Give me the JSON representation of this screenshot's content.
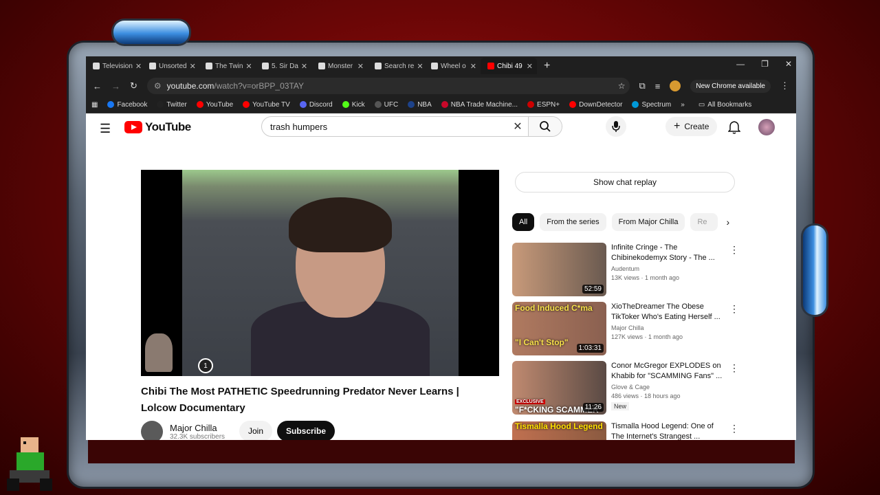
{
  "tabs": [
    {
      "label": "Television"
    },
    {
      "label": "Unsorted"
    },
    {
      "label": "The Twin"
    },
    {
      "label": "5. Sir Da"
    },
    {
      "label": "Monster"
    },
    {
      "label": "Search re"
    },
    {
      "label": "Wheel o"
    },
    {
      "label": "Chibi 49"
    }
  ],
  "address": {
    "url_host": "youtube.com",
    "url_path": "/watch?v=orBPP_03TAY",
    "new_chrome": "New Chrome available"
  },
  "bookmarks": [
    {
      "label": "Facebook",
      "color": "#1877f2"
    },
    {
      "label": "Twitter",
      "color": "#222222"
    },
    {
      "label": "YouTube",
      "color": "#ff0000"
    },
    {
      "label": "YouTube TV",
      "color": "#ff0000"
    },
    {
      "label": "Discord",
      "color": "#5865f2"
    },
    {
      "label": "Kick",
      "color": "#53fc18"
    },
    {
      "label": "UFC",
      "color": "#555555"
    },
    {
      "label": "NBA",
      "color": "#1d428a"
    },
    {
      "label": "NBA Trade Machine...",
      "color": "#c9082a"
    },
    {
      "label": "ESPN+",
      "color": "#cc0000"
    },
    {
      "label": "DownDetector",
      "color": "#ff0000"
    },
    {
      "label": "Spectrum",
      "color": "#0099d8"
    }
  ],
  "all_bookmarks": "All Bookmarks",
  "youtube": {
    "logo": "YouTube",
    "search_value": "trash humpers",
    "create": "Create"
  },
  "video": {
    "title": "Chibi The Most PATHETIC Speedrunning Predator Never Learns | Lolcow Documentary",
    "channel": "Major Chilla",
    "subscribers": "32.3K subscribers",
    "join": "Join",
    "subscribe": "Subscribe",
    "badge": "1"
  },
  "sidebar": {
    "chat_replay": "Show chat replay",
    "chips": [
      "All",
      "From the series",
      "From Major Chilla",
      "Re"
    ],
    "recommendations": [
      {
        "title": "Infinite Cringe - The Chibinekodemyx Story - The ...",
        "channel": "Audentum",
        "meta": "13K views · 1 month ago",
        "duration": "52:59",
        "caption": "",
        "thumb": "#b88a6a"
      },
      {
        "title": "XioTheDreamer The Obese TikToker Who's Eating Herself ...",
        "channel": "Major Chilla",
        "meta": "127K views · 1 month ago",
        "duration": "1:03:31",
        "caption": "Food Induced C*ma",
        "caption2": "\"I Can't Stop\"",
        "thumb": "#9a6a5a"
      },
      {
        "title": "Conor McGregor EXPLODES on Khabib for \"SCAMMING Fans\" ...",
        "channel": "Glove & Cage",
        "meta": "486 views · 18 hours ago",
        "duration": "11:26",
        "caption": "EXCLUSIVE",
        "caption2": "\"F*CKING SCAMMER\"",
        "new": "New",
        "thumb": "#7a5a4a"
      },
      {
        "title": "Tismalla Hood Legend: One of The Internet's Strangest ...",
        "channel": "",
        "meta": "",
        "duration": "",
        "caption": "Tismalla Hood Legend",
        "thumb": "#a06a50"
      }
    ]
  }
}
